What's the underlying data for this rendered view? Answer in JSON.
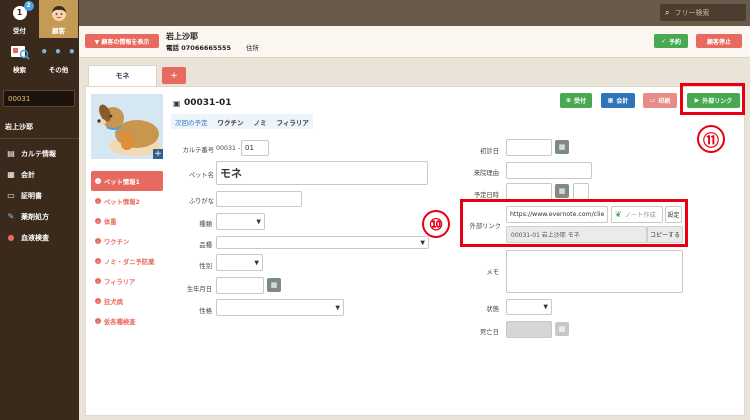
{
  "sidebar": {
    "nav": [
      {
        "label": "受付",
        "icon": "reception-icon",
        "badge": "2",
        "glyph": "1"
      },
      {
        "label": "顧客",
        "icon": "customer-face-icon",
        "active": true
      },
      {
        "label": "検索",
        "icon": "search-card-icon"
      },
      {
        "label": "その他",
        "icon": "more-dots-icon",
        "glyph": "• • •"
      }
    ],
    "patient_id": "00031",
    "patient_name": "岩上沙耶",
    "menu": [
      {
        "label": "カルテ情報",
        "icon": "chart-card-icon",
        "glyph": "▤"
      },
      {
        "label": "会計",
        "icon": "accounting-icon",
        "glyph": "▦"
      },
      {
        "label": "証明書",
        "icon": "certificate-icon",
        "glyph": "▭"
      },
      {
        "label": "薬剤処方",
        "icon": "medicine-icon",
        "glyph": "✎"
      },
      {
        "label": "血液検査",
        "icon": "blood-drop-icon",
        "glyph": "●"
      }
    ]
  },
  "topbar": {
    "search_placeholder": "フリー検索"
  },
  "header": {
    "show_customer_button": "▼ 顧客の情報を表示",
    "owner_name": "岩上沙耶",
    "phone_label": "電話",
    "phone": "07066665555",
    "address_label": "住所",
    "reserve_button": "予約",
    "stop_button": "顧客停止"
  },
  "tabs": {
    "active": "モネ",
    "add": "+"
  },
  "pet": {
    "id": "00031-01",
    "mini_tabs": [
      "次回の予定",
      "ワクチン",
      "ノミ",
      "フィラリア"
    ],
    "actions": {
      "reception": "受付",
      "accounting": "会計",
      "print": "印刷",
      "external": "外部リンク"
    },
    "menu": [
      "ペット情報1",
      "ペット情報2",
      "体重",
      "ワクチン",
      "ノミ・ダニ予防薬",
      "フィラリア",
      "狂犬病",
      "仮各種検査"
    ]
  },
  "form": {
    "karte_label": "カルテ番号",
    "karte_prefix": "00031 -",
    "karte_suffix": "01",
    "pet_name_label": "ペット名",
    "pet_name": "モネ",
    "furigana_label": "ふりがな",
    "species_label": "種類",
    "breed_label": "品種",
    "sex_label": "性別",
    "birth_label": "生年月日",
    "temper_label": "性格",
    "first_visit_label": "初診日",
    "reason_label": "来院理由",
    "due_label": "予定日時",
    "ext_link_label": "外部リンク",
    "ext_url": "https://www.evernote.com/clie",
    "note_button": "ノート作成",
    "settings_button": "設定",
    "ext_note": "00031-01 岩上沙耶 モネ",
    "copy_button": "コピーする",
    "memo_label": "メモ",
    "status_label": "状態",
    "death_label": "死亡日"
  },
  "callouts": {
    "ten": "⑩",
    "eleven": "⑪"
  },
  "colors": {
    "accent": "#e8695f",
    "green": "#48a950",
    "blue": "#2f73b8",
    "highlight": "#e60012"
  }
}
